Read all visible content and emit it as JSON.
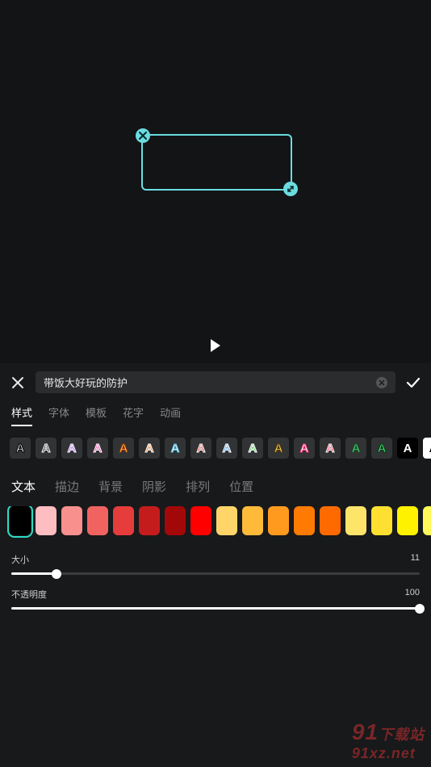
{
  "text_input": "带饭大好玩的防护",
  "tabs": [
    "样式",
    "字体",
    "模板",
    "花字",
    "动画"
  ],
  "active_tab": 0,
  "text_styles": [
    {
      "bg": "#313335",
      "color": "#ffffff",
      "stroke": "#000000"
    },
    {
      "bg": "#313335",
      "color": "#313335",
      "stroke": "#ffffff"
    },
    {
      "bg": "#313335",
      "color": "#b86cff",
      "stroke": "#ffffff"
    },
    {
      "bg": "#313335",
      "color": "#ff4db0",
      "stroke": "#ffffff"
    },
    {
      "bg": "#313335",
      "color": "#ffd24d",
      "stroke": "#a0320a"
    },
    {
      "bg": "#313335",
      "color": "#f08c3e",
      "stroke": "#ffffff"
    },
    {
      "bg": "#313335",
      "color": "#ffffff",
      "stroke": "#50b4d8"
    },
    {
      "bg": "#313335",
      "color": "#e04a4a",
      "stroke": "#ffffff"
    },
    {
      "bg": "#313335",
      "color": "#5aa8ff",
      "stroke": "#ffffff"
    },
    {
      "bg": "#313335",
      "color": "#6dd06d",
      "stroke": "#ffffff"
    },
    {
      "bg": "#313335",
      "color": "#ffe66d",
      "stroke": "#5a3a00"
    },
    {
      "bg": "#313335",
      "color": "#ffffff",
      "stroke": "#ff3a7a"
    },
    {
      "bg": "#313335",
      "color": "#ff3a5a",
      "stroke": "#ffffff"
    },
    {
      "bg": "#313335",
      "color": "#6dd06d",
      "stroke": "#0c5f30"
    },
    {
      "bg": "#313335",
      "color": "#4dff7a",
      "stroke": "#0a3a18"
    },
    {
      "bg": "#000000",
      "color": "#ffffff",
      "stroke": "none"
    },
    {
      "bg": "#ffffff",
      "color": "#000000",
      "stroke": "none"
    },
    {
      "bg": "#ffe03a",
      "color": "#000000",
      "stroke": "none"
    }
  ],
  "selected_style_index": 17,
  "subtabs": [
    "文本",
    "描边",
    "背景",
    "阴影",
    "排列",
    "位置"
  ],
  "active_subtab": 0,
  "colors": [
    "#000000",
    "#fdbdc1",
    "#f8908e",
    "#f16361",
    "#e63c3c",
    "#c41c1c",
    "#a30808",
    "#ff0000",
    "#ffd56a",
    "#ffba3a",
    "#ff9a1f",
    "#ff7a00",
    "#ff6a00",
    "#ffe46a",
    "#ffe030",
    "#fff200",
    "#fff95a"
  ],
  "selected_color_index": 0,
  "size": {
    "label": "大小",
    "value": 11,
    "min": 0,
    "max": 100
  },
  "opacity": {
    "label": "不透明度",
    "value": 100,
    "min": 0,
    "max": 100
  },
  "watermark_text": "91xz.net",
  "watermark_prefix": "91",
  "watermark_cn": "下载站"
}
